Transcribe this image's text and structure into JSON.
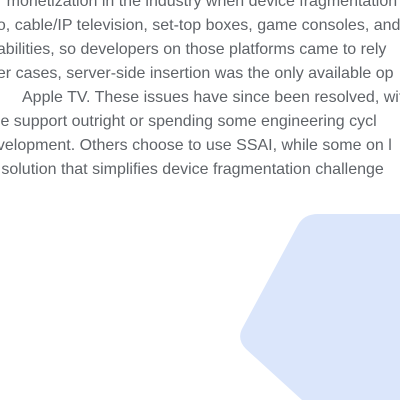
{
  "article": {
    "lines": [
      "er monetization in the industry when device fragmentation",
      "eo, cable/IP television, set-top boxes, game consoles, and",
      "pabilities, so developers on those platforms came to rely",
      "her cases, server-side insertion was the only available op",
      "Apple TV. These issues have since been resolved, with",
      "ide support outright or spending some engineering cycl",
      "evelopment. Others choose to use SSAI, while some on l",
      "e solution that simplifies device fragmentation challenge"
    ]
  },
  "decoration": {
    "hexagon_color": "#dbe6fb",
    "text_color": "#5f6368"
  }
}
